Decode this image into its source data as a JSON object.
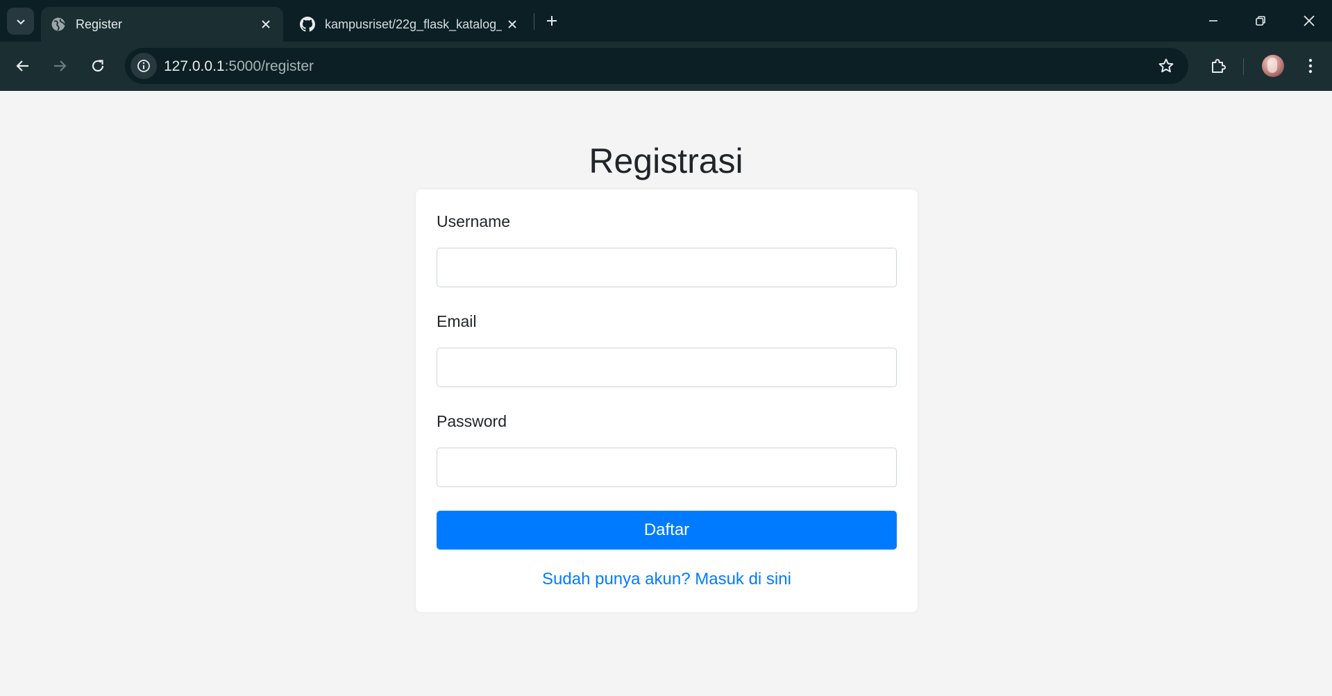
{
  "browser": {
    "tabs": [
      {
        "title": "Register",
        "favicon": "globe-icon",
        "active": true
      },
      {
        "title": "kampusriset/22g_flask_katalog_",
        "favicon": "github-icon",
        "active": false
      }
    ],
    "address": {
      "host": "127.0.0.1",
      "path": ":5000/register"
    }
  },
  "page": {
    "title": "Registrasi",
    "form": {
      "username_label": "Username",
      "username_value": "",
      "email_label": "Email",
      "email_value": "",
      "password_label": "Password",
      "password_value": "",
      "submit_label": "Daftar",
      "login_link": "Sudah punya akun? Masuk di sini"
    }
  },
  "colors": {
    "primary": "#007bff",
    "page_background": "#f4f4f4",
    "chrome_dark": "#0c1f24",
    "chrome_toolbar": "#1b2e32"
  }
}
